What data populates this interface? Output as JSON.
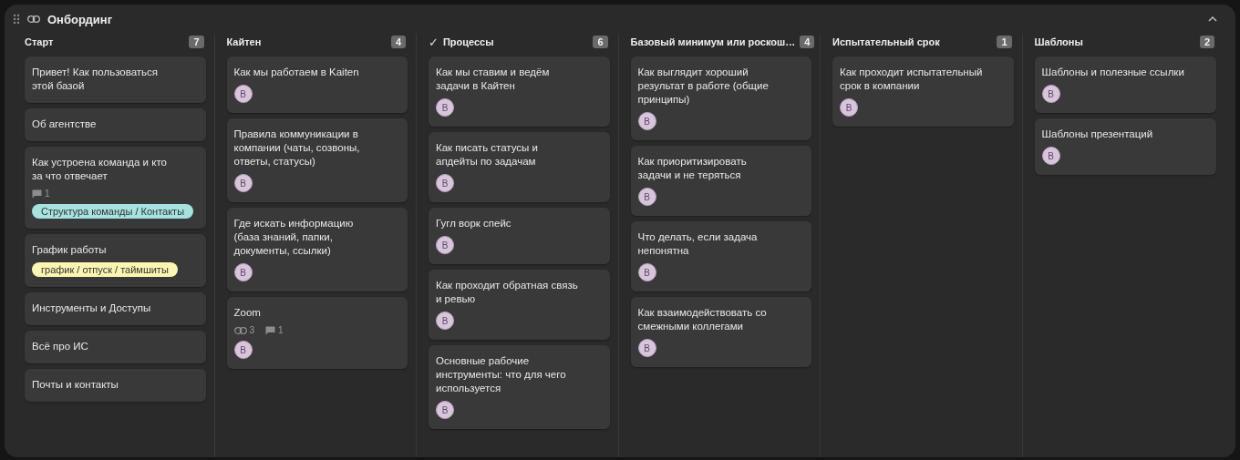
{
  "board": {
    "title": "Онбординг",
    "collapsed": false
  },
  "columns": [
    {
      "title": "Старт",
      "count": "7",
      "cards": [
        {
          "title": "Привет! Как пользоваться этой базой"
        },
        {
          "title": "Об агентстве"
        },
        {
          "title": "Как устроена команда и кто за что отвечает",
          "comments": "1",
          "tags": [
            {
              "label": "Структура команды / Контакты",
              "color": "#a6e3e0"
            }
          ]
        },
        {
          "title": "График работы",
          "tags": [
            {
              "label": "график / отпуск / таймшиты",
              "color": "#fdf6b2"
            }
          ]
        },
        {
          "title": "Инструменты и Доступы"
        },
        {
          "title": "Всё про ИС"
        },
        {
          "title": "Почты и контакты"
        }
      ]
    },
    {
      "title": "Кайтен",
      "count": "4",
      "cards": [
        {
          "title": "Как мы работаем в Kaiten",
          "avatar": "В"
        },
        {
          "title": "Правила коммуникации в компании (чаты, созвоны, ответы, статусы)",
          "avatar": "В"
        },
        {
          "title": "Где искать информацию (база знаний, папки, документы, ссылки)",
          "avatar": "В"
        },
        {
          "title": "Zoom",
          "links": "3",
          "comments": "1",
          "avatar": "В"
        }
      ]
    },
    {
      "title": "Процессы",
      "mark": "✓",
      "count": "6",
      "cards": [
        {
          "title": "Как мы ставим и ведём задачи в Кайтен",
          "avatar": "В"
        },
        {
          "title": "Как писать статусы и апдейты по задачам",
          "avatar": "В"
        },
        {
          "title": "Гугл ворк спейс",
          "avatar": "В"
        },
        {
          "title": "Как проходит обратная связь и ревью",
          "avatar": "В"
        },
        {
          "title": "Основные рабочие инструменты: что для чего используется",
          "avatar": "В"
        }
      ]
    },
    {
      "title": "Базовый минимум или роскош…",
      "count": "4",
      "cards": [
        {
          "title": "Как выглядит хороший результат в работе (общие принципы)",
          "avatar": "В"
        },
        {
          "title": "Как приоритизировать задачи и не теряться",
          "avatar": "В"
        },
        {
          "title": "Что делать, если задача непонятна",
          "avatar": "В"
        },
        {
          "title": "Как взаимодействовать со смежными коллегами",
          "avatar": "В"
        }
      ]
    },
    {
      "title": "Испытательный срок",
      "count": "1",
      "cards": [
        {
          "title": "Как проходит испытательный срок в компании",
          "avatar": "В"
        }
      ]
    },
    {
      "title": "Шаблоны",
      "count": "2",
      "cards": [
        {
          "title": "Шаблоны и полезные ссылки",
          "avatar": "В"
        },
        {
          "title": "Шаблоны презентаций",
          "avatar": "В"
        }
      ]
    }
  ]
}
